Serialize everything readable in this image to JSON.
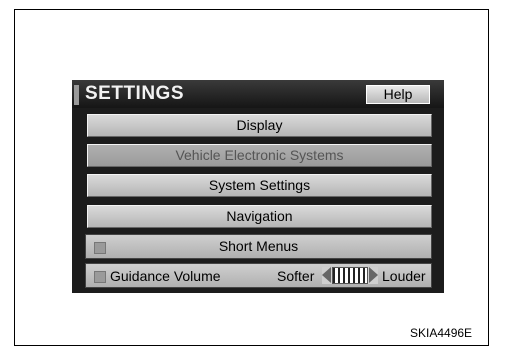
{
  "screen": {
    "title": "SETTINGS",
    "help_label": "Help",
    "menu": [
      {
        "label": "Display",
        "enabled": true
      },
      {
        "label": "Vehicle Electronic Systems",
        "enabled": false
      },
      {
        "label": "System Settings",
        "enabled": true
      },
      {
        "label": "Navigation",
        "enabled": true
      }
    ],
    "short_menus_label": "Short Menus",
    "guidance": {
      "label": "Guidance Volume",
      "softer_label": "Softer",
      "louder_label": "Louder"
    }
  },
  "figure_code": "SKIA4496E"
}
